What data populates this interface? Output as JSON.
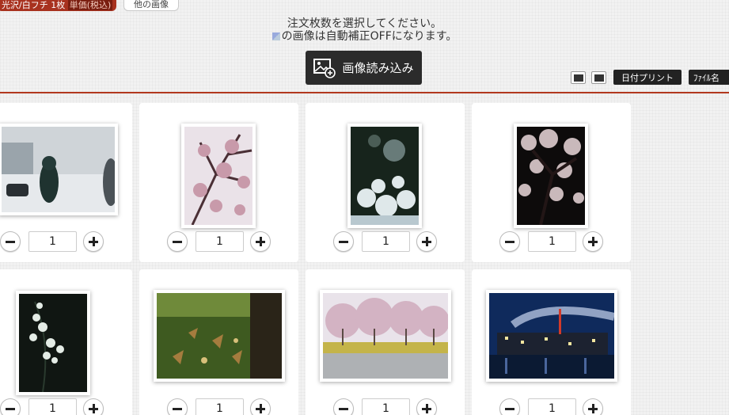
{
  "header": {
    "badge_prefix": "光沢/白フチ 1枚",
    "badge_highlight": "単価(税込)",
    "tab_label": "他の画像"
  },
  "instructions": {
    "line1": "注文枚数を選択してください。",
    "line2": "の画像は自動補正OFFになります。"
  },
  "upload_button": {
    "label": "画像読み込み",
    "icon": "add-image-icon"
  },
  "toolbar": {
    "icon1": "layout-view-icon",
    "icon2": "layout-grid-icon",
    "date_print_label": "日付プリント",
    "filename_label": "ﾌｧｲﾙ名"
  },
  "photos": [
    {
      "subject": "child-in-snow",
      "quantity": "1",
      "colors": [
        "#cfd4d8",
        "#1a2a2a"
      ]
    },
    {
      "subject": "cherry-blossoms-branches",
      "quantity": "1",
      "colors": [
        "#e9dfe6",
        "#5e3b45"
      ]
    },
    {
      "subject": "white-flowers-dark",
      "quantity": "1",
      "colors": [
        "#1d2a22",
        "#d9e4e6"
      ]
    },
    {
      "subject": "night-cherry-blossoms",
      "quantity": "1",
      "colors": [
        "#0d0b0b",
        "#cdbfbf"
      ]
    },
    {
      "subject": "white-blossoms-dark",
      "quantity": "1",
      "colors": [
        "#111714",
        "#e6eee8"
      ]
    },
    {
      "subject": "autumn-leaves-moss",
      "quantity": "1",
      "colors": [
        "#3e5a20",
        "#8a6a3a"
      ]
    },
    {
      "subject": "cherry-tree-park",
      "quantity": "1",
      "colors": [
        "#d8c4cf",
        "#b9a84a"
      ]
    },
    {
      "subject": "industrial-night",
      "quantity": "1",
      "colors": [
        "#0f2a5c",
        "#c9d6f0"
      ]
    }
  ],
  "stepper": {
    "minus_icon": "minus-icon",
    "plus_icon": "plus-icon"
  },
  "colors": {
    "accent_red": "#a8321f",
    "button_dark": "#2b2b2b"
  }
}
